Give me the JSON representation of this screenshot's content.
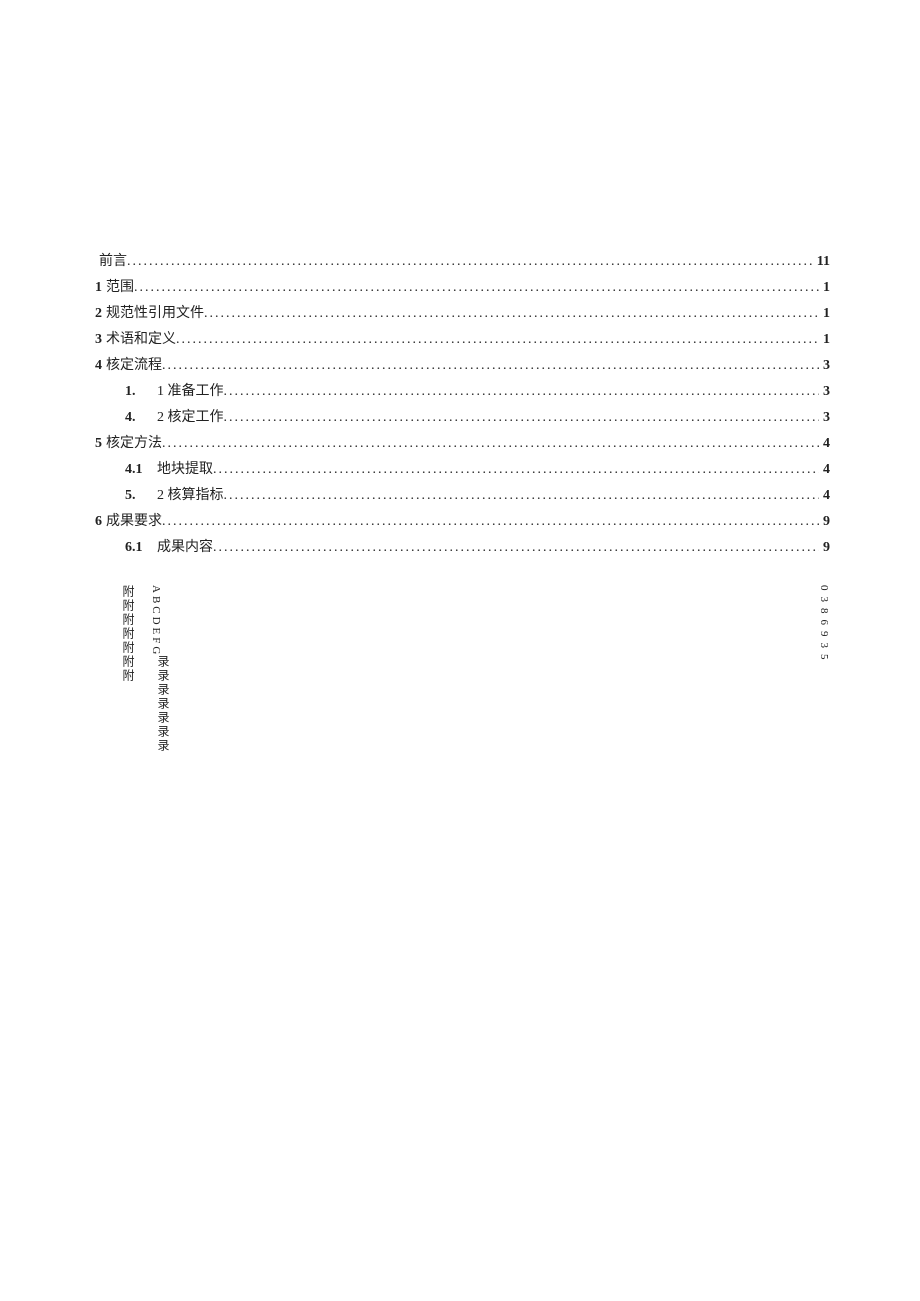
{
  "toc": [
    {
      "num": "",
      "label": "前言",
      "page": "11",
      "indent": 0
    },
    {
      "num": "1",
      "label": "范围",
      "page": "1",
      "indent": 0
    },
    {
      "num": "2",
      "label": "规范性引用文件",
      "page": "1",
      "indent": 0
    },
    {
      "num": "3",
      "label": "术语和定义",
      "page": "1",
      "indent": 0
    },
    {
      "num": "4",
      "label": "核定流程",
      "page": "3",
      "indent": 0
    },
    {
      "num": "1.",
      "label": "1 准备工作",
      "page": "3",
      "indent": 1
    },
    {
      "num": "4.",
      "label": "2 核定工作",
      "page": "3",
      "indent": 1
    },
    {
      "num": "5",
      "label": "核定方法",
      "page": "4",
      "indent": 0
    },
    {
      "num": "4.1",
      "label": "地块提取",
      "page": "4",
      "indent": 1
    },
    {
      "num": "5.",
      "label": "2 核算指标",
      "page": "4",
      "indent": 1
    },
    {
      "num": "6",
      "label": "成果要求",
      "page": "9",
      "indent": 0
    },
    {
      "num": "6.1",
      "label": "成果内容",
      "page": "9",
      "indent": 1
    }
  ],
  "appendix": {
    "col1": "附附附附附附附",
    "letters": "ABCDEFG",
    "col2": "录录录录录录录",
    "pages": "0386935"
  },
  "dots": "................................................................................................................................................................"
}
